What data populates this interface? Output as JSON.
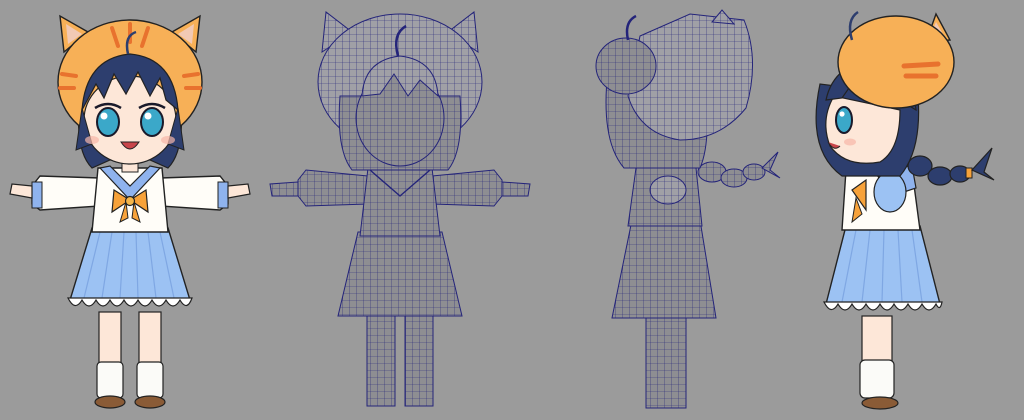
{
  "scene": {
    "background": "#9b9b9b",
    "views": [
      {
        "id": "front-textured",
        "kind": "textured",
        "angle": "front"
      },
      {
        "id": "front-wireframe",
        "kind": "wireframe",
        "angle": "front"
      },
      {
        "id": "side-wireframe",
        "kind": "wireframe",
        "angle": "side-left"
      },
      {
        "id": "side-textured",
        "kind": "textured",
        "angle": "side-right"
      }
    ]
  },
  "colors": {
    "hair": "#2d3e6e",
    "hat": "#f7b057",
    "hat_stripe": "#e8722e",
    "skin": "#fde7d8",
    "eye": "#3ba8c9",
    "shirt": "#fffdf8",
    "collar": "#8fb3ee",
    "bow": "#f7a23a",
    "skirt": "#9cc2f3",
    "skirt_dark": "#7fa7e3",
    "frill": "#ffffff",
    "sock": "#fbfbf8",
    "shoe": "#8a5b36",
    "mesh_fill": "#8e8e92",
    "mesh_line": "#24247a",
    "outline": "#222222"
  }
}
